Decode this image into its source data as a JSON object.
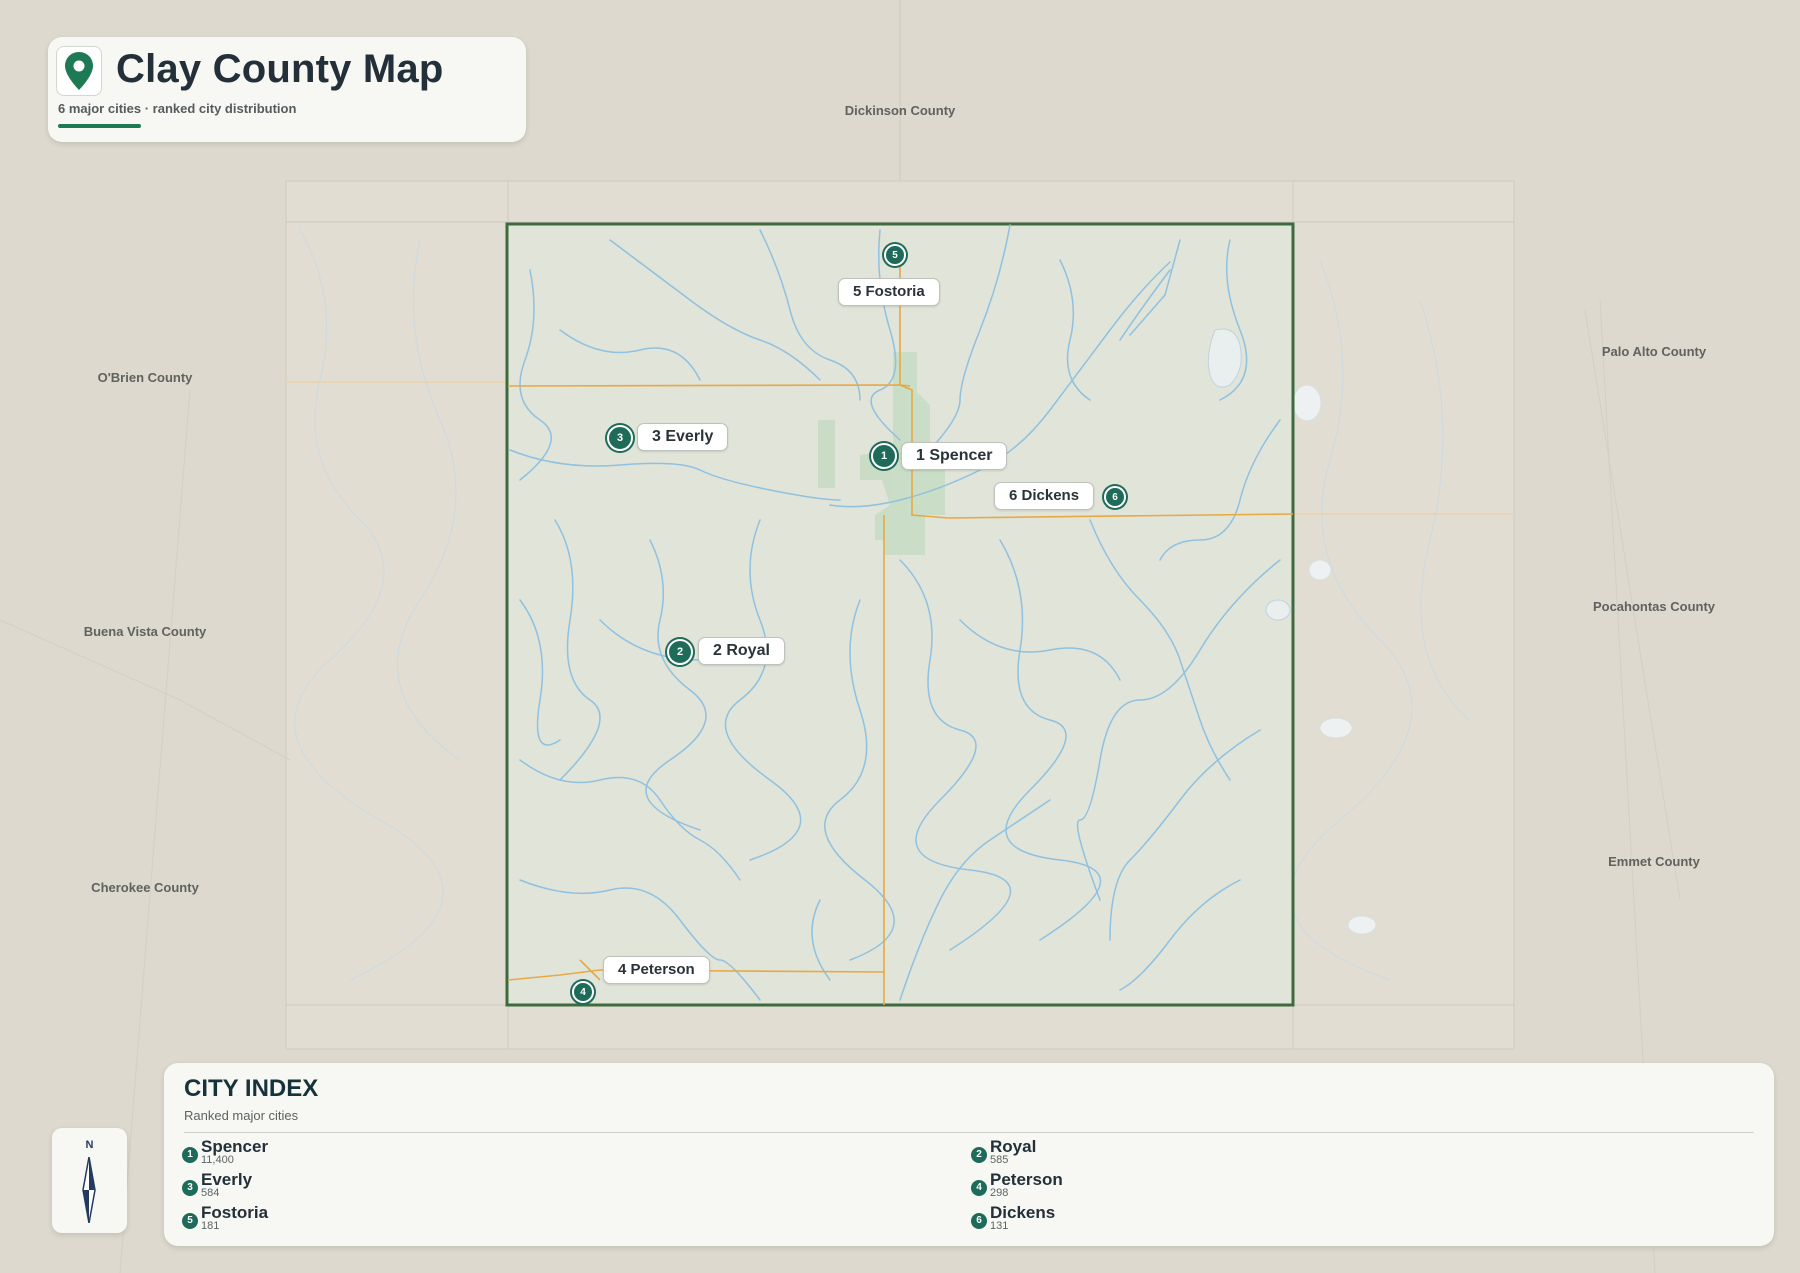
{
  "header": {
    "title": "Clay County Map",
    "subtitle": "6 major cities · ranked city distribution",
    "icon": "map-pin-icon",
    "accent_color": "#1e7a55"
  },
  "neighbor_counties": {
    "north": "Dickinson County",
    "west_upper": "O'Brien County",
    "west_middle": "Buena Vista County",
    "west_lower": "Cherokee County",
    "east_upper": "Palo Alto County",
    "east_middle": "Pocahontas County",
    "east_lower": "Emmet County"
  },
  "map_labels": {
    "spencer": "1 Spencer",
    "royal": "2 Royal",
    "everly": "3 Everly",
    "peterson": "4 Peterson",
    "fostoria": "5 Fostoria",
    "dickens": "6 Dickens"
  },
  "markers": {
    "spencer": "1",
    "royal": "2",
    "everly": "3",
    "peterson": "4",
    "fostoria": "5",
    "dickens": "6"
  },
  "compass": {
    "north_label": "N",
    "icon": "compass-icon"
  },
  "city_index": {
    "title": "CITY INDEX",
    "subtitle": "Ranked major cities",
    "cities": [
      {
        "rank": "1",
        "name": "Spencer",
        "population": "11,400"
      },
      {
        "rank": "2",
        "name": "Royal",
        "population": "585"
      },
      {
        "rank": "3",
        "name": "Everly",
        "population": "584"
      },
      {
        "rank": "4",
        "name": "Peterson",
        "population": "298"
      },
      {
        "rank": "5",
        "name": "Fostoria",
        "population": "181"
      },
      {
        "rank": "6",
        "name": "Dickens",
        "population": "131"
      }
    ]
  },
  "colors": {
    "background": "#ddd9ce",
    "county_fill": "#e1e4d8",
    "county_border": "#3d6b3f",
    "river": "#8fc1e0",
    "road": "#e8a943",
    "urban": "#c8dcc4",
    "marker": "#1e6b59"
  }
}
